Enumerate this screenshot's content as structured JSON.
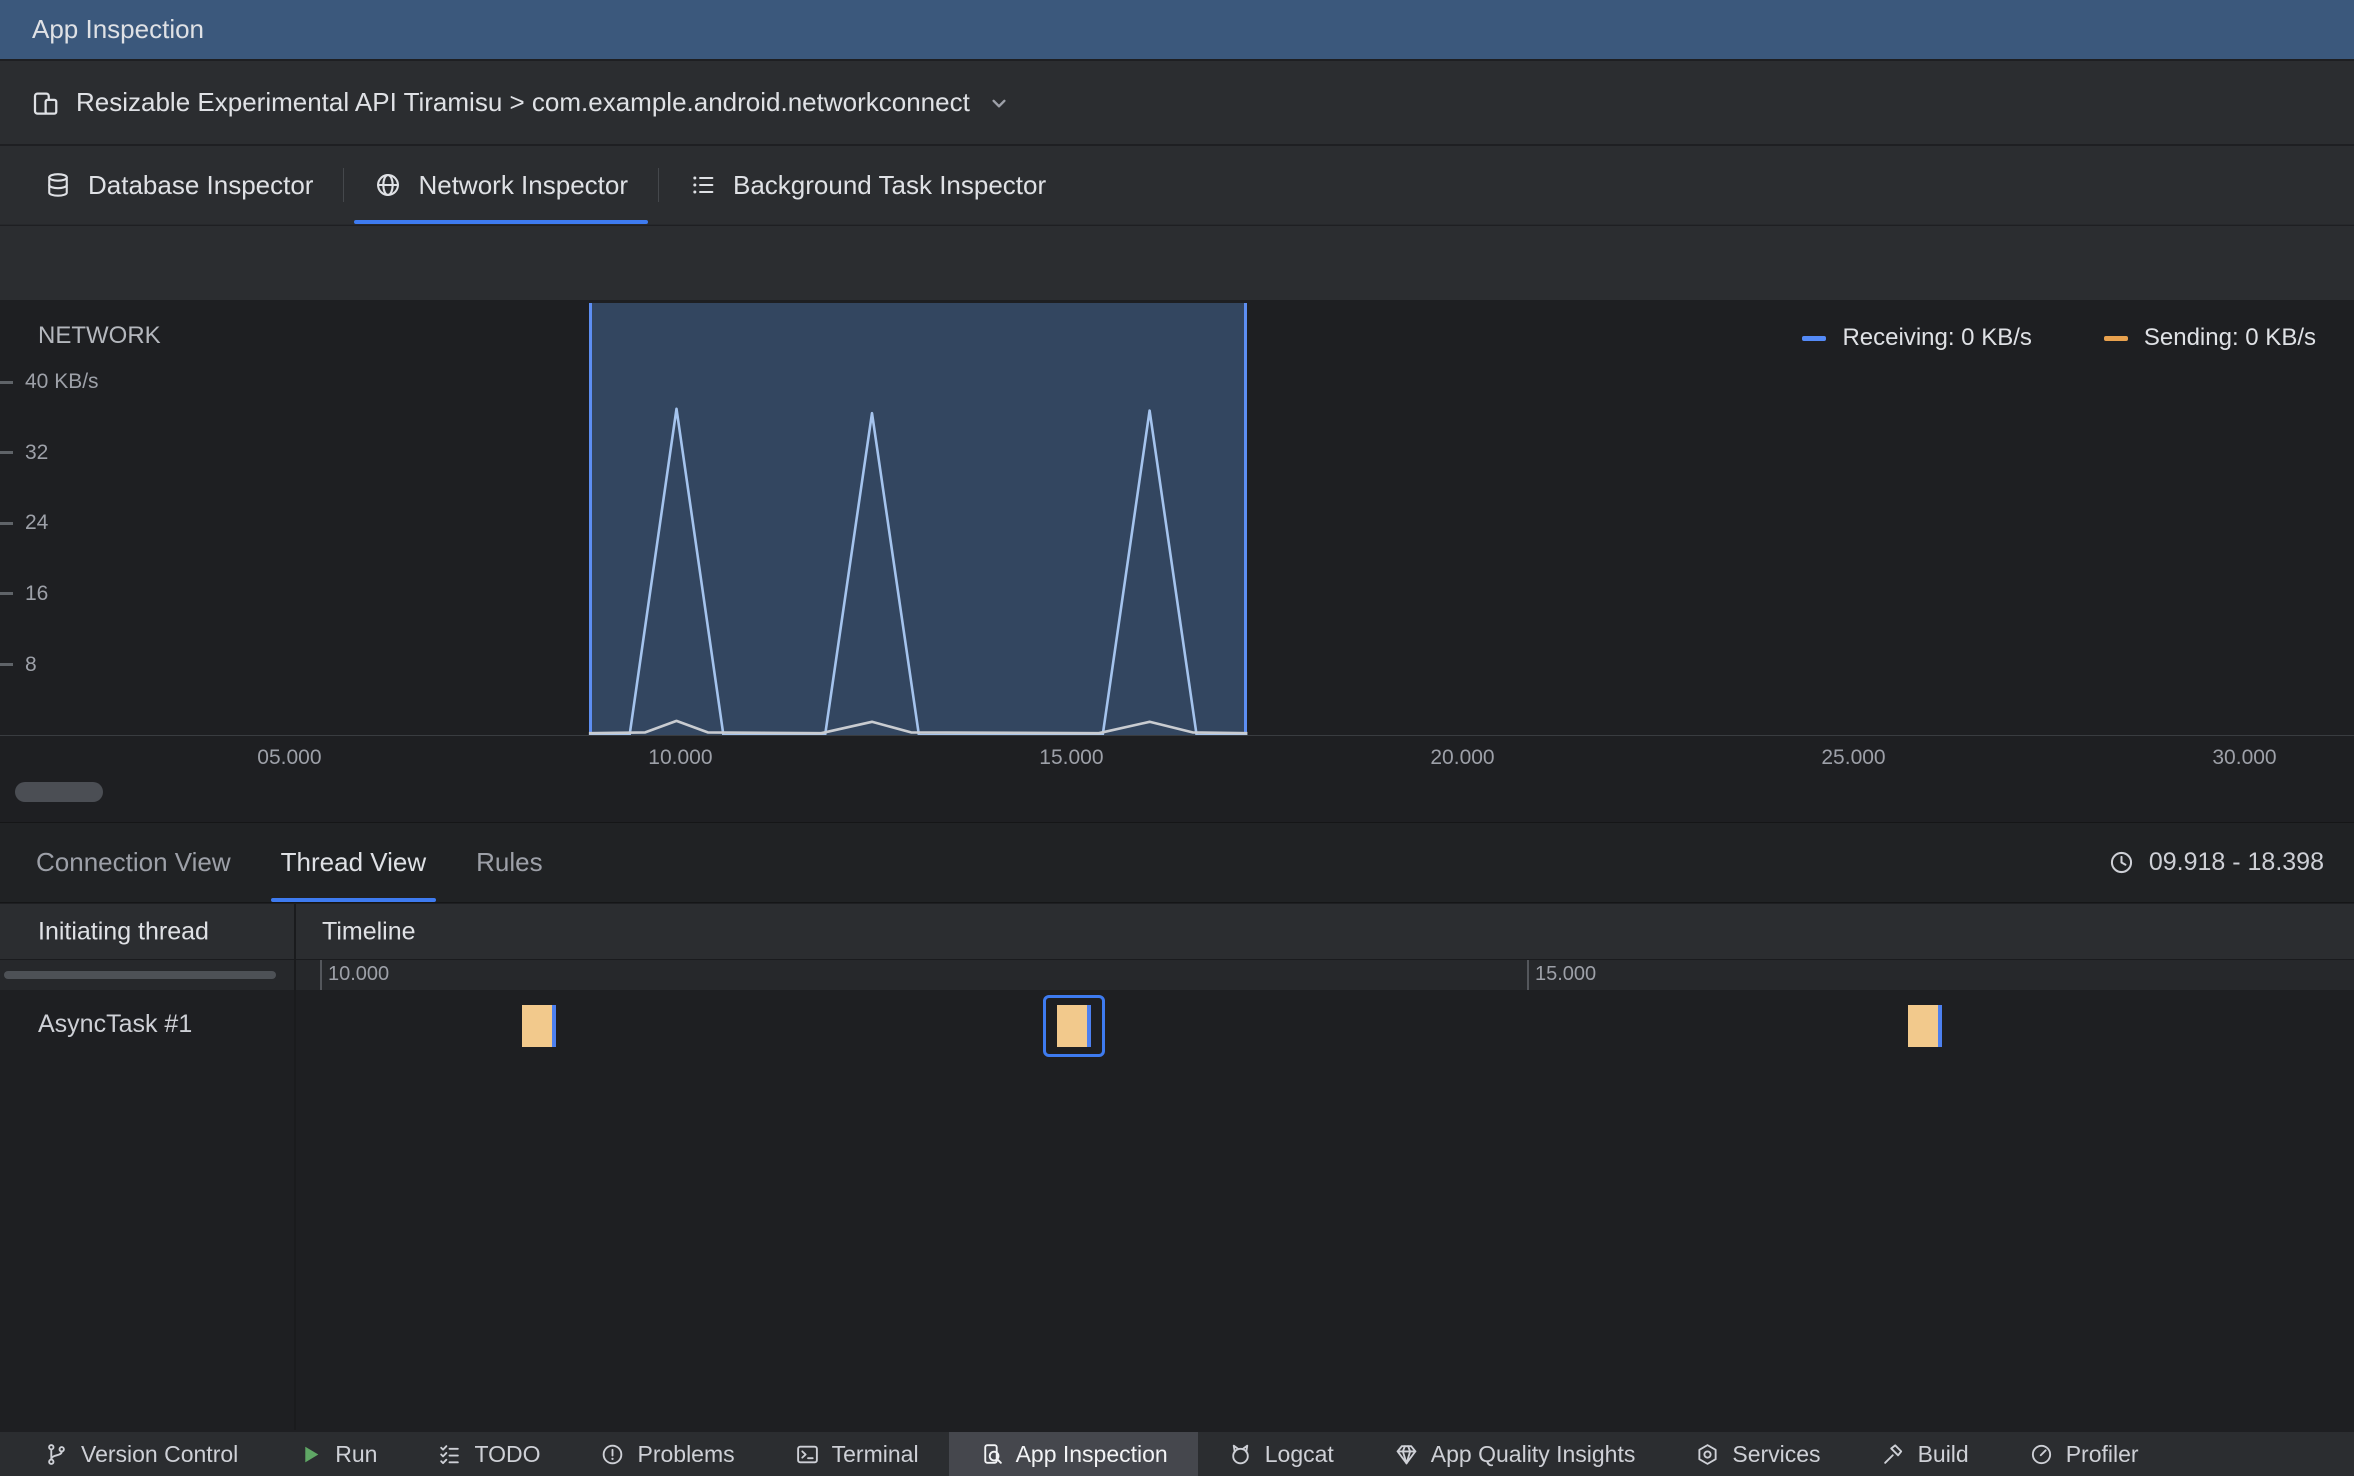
{
  "window": {
    "title": "App Inspection"
  },
  "process_bar": {
    "label": "Resizable Experimental API Tiramisu > com.example.android.networkconnect"
  },
  "inspector_tabs": {
    "items": [
      {
        "label": "Database Inspector",
        "icon": "database-icon",
        "selected": false
      },
      {
        "label": "Network Inspector",
        "icon": "globe-icon",
        "selected": true
      },
      {
        "label": "Background Task Inspector",
        "icon": "checklist-icon",
        "selected": false
      }
    ]
  },
  "chart": {
    "label": "NETWORK",
    "legend": [
      {
        "label": "Receiving: 0 KB/s",
        "color": "#548af7"
      },
      {
        "label": "Sending: 0 KB/s",
        "color": "#e8a14e"
      }
    ]
  },
  "chart_data": {
    "type": "line",
    "title": "NETWORK",
    "y_unit": "KB/s",
    "xlim": [
      1.3,
      31.4
    ],
    "ylim": [
      0,
      49
    ],
    "grid": false,
    "legend_position": "top-right",
    "x_ticks": [
      {
        "t": 5,
        "label": "05.000"
      },
      {
        "t": 10,
        "label": "10.000"
      },
      {
        "t": 15,
        "label": "15.000"
      },
      {
        "t": 20,
        "label": "20.000"
      },
      {
        "t": 25,
        "label": "25.000"
      },
      {
        "t": 30,
        "label": "30.000"
      }
    ],
    "y_ticks": [
      {
        "v": 40,
        "label": "40 KB/s"
      },
      {
        "v": 32,
        "label": "32"
      },
      {
        "v": 24,
        "label": "24"
      },
      {
        "v": 16,
        "label": "16"
      },
      {
        "v": 8,
        "label": "8"
      }
    ],
    "selection": {
      "start": 8.83,
      "end": 17.25,
      "label": "09.918 - 18.398"
    },
    "series": [
      {
        "name": "Receiving",
        "current_value": "0 KB/s",
        "color": "#a5c4ee",
        "points": [
          [
            8.83,
            0
          ],
          [
            9.35,
            0
          ],
          [
            9.95,
            37
          ],
          [
            10.55,
            0
          ],
          [
            11.85,
            0
          ],
          [
            12.45,
            36.5
          ],
          [
            13.05,
            0
          ],
          [
            15.4,
            0
          ],
          [
            16.0,
            36.8
          ],
          [
            16.6,
            0
          ],
          [
            17.25,
            0
          ]
        ]
      },
      {
        "name": "Sending",
        "current_value": "0 KB/s",
        "color": "#c9ccd1",
        "points": [
          [
            8.83,
            0.2
          ],
          [
            9.55,
            0.3
          ],
          [
            9.95,
            1.6
          ],
          [
            10.35,
            0.3
          ],
          [
            11.8,
            0.2
          ],
          [
            12.45,
            1.5
          ],
          [
            12.95,
            0.3
          ],
          [
            15.35,
            0.2
          ],
          [
            16.0,
            1.5
          ],
          [
            16.55,
            0.3
          ],
          [
            17.25,
            0.2
          ]
        ]
      }
    ]
  },
  "detail_tabs": {
    "items": [
      {
        "label": "Connection View",
        "selected": false
      },
      {
        "label": "Thread View",
        "selected": true
      },
      {
        "label": "Rules",
        "selected": false
      }
    ],
    "time_range": "09.918 - 18.398"
  },
  "thread_table": {
    "columns": [
      "Initiating thread",
      "Timeline"
    ],
    "timeline_ticks": [
      "10.000",
      "15.000"
    ],
    "rows": [
      {
        "thread": "AsyncTask #1",
        "connection_count": 3,
        "selected_connection_index": 1
      }
    ]
  },
  "statusbar": {
    "items": [
      {
        "label": "Version Control",
        "icon": "branch-icon",
        "selected": false
      },
      {
        "label": "Run",
        "icon": "run-icon",
        "selected": false
      },
      {
        "label": "TODO",
        "icon": "todo-icon",
        "selected": false
      },
      {
        "label": "Problems",
        "icon": "problems-icon",
        "selected": false
      },
      {
        "label": "Terminal",
        "icon": "terminal-icon",
        "selected": false
      },
      {
        "label": "App Inspection",
        "icon": "app-inspection-icon",
        "selected": true
      },
      {
        "label": "Logcat",
        "icon": "logcat-icon",
        "selected": false
      },
      {
        "label": "App Quality Insights",
        "icon": "insights-icon",
        "selected": false
      },
      {
        "label": "Services",
        "icon": "services-icon",
        "selected": false
      },
      {
        "label": "Build",
        "icon": "build-icon",
        "selected": false
      },
      {
        "label": "Profiler",
        "icon": "profiler-icon",
        "selected": false
      }
    ]
  },
  "colors": {
    "accent_blue": "#3e7bf0",
    "selection_border": "#5d8ef2",
    "connection_block": "#f2c98c",
    "titlebar_background": "#3b587c"
  }
}
